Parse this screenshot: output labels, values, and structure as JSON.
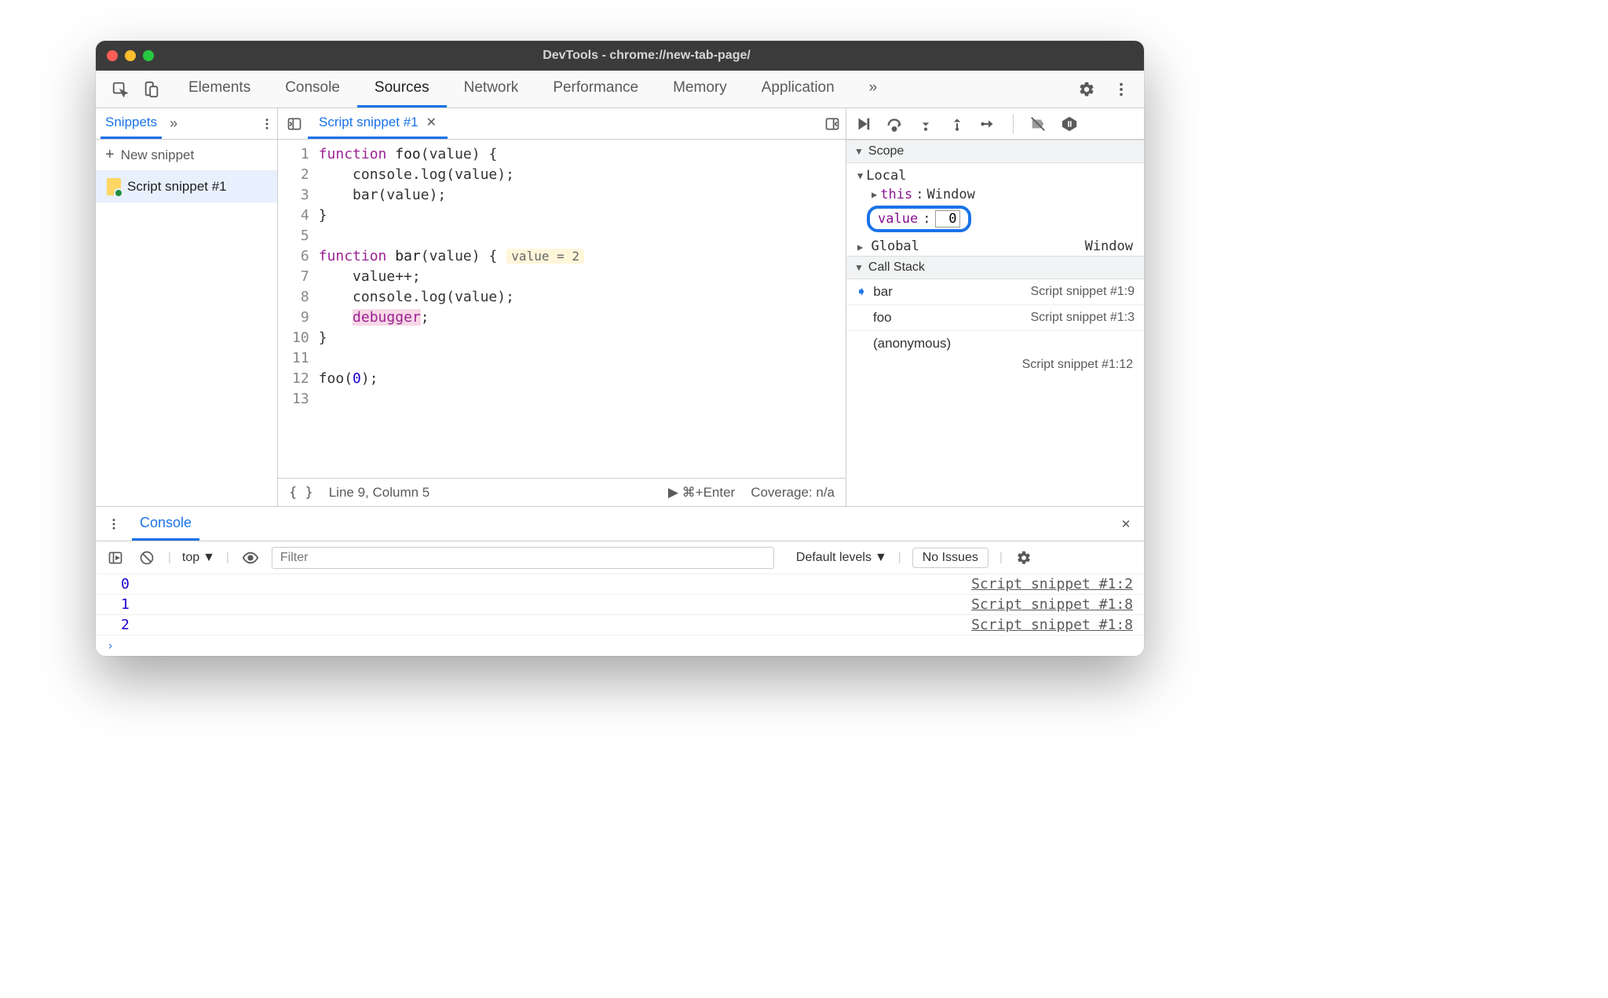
{
  "window": {
    "title": "DevTools - chrome://new-tab-page/"
  },
  "main_tabs": [
    "Elements",
    "Console",
    "Sources",
    "Network",
    "Performance",
    "Memory",
    "Application"
  ],
  "main_tab_active": "Sources",
  "sidebar": {
    "nav_label": "Snippets",
    "new_snippet": "New snippet",
    "items": [
      "Script snippet #1"
    ]
  },
  "editor": {
    "open_file": "Script snippet #1",
    "lines": [
      "function foo(value) {",
      "    console.log(value);",
      "    bar(value);",
      "}",
      "",
      "function bar(value) {",
      "    value++;",
      "    console.log(value);",
      "    debugger;",
      "}",
      "",
      "foo(0);",
      ""
    ],
    "inline_hint": "value = 2",
    "exec_line": 9,
    "status": {
      "cursor": "Line 9, Column 5",
      "run_hint": "⌘+Enter",
      "coverage": "Coverage: n/a"
    }
  },
  "debugger": {
    "scope_label": "Scope",
    "local_label": "Local",
    "local": {
      "this_key": "this",
      "this_val": "Window",
      "value_key": "value",
      "value_val": "0"
    },
    "global_key": "Global",
    "global_val": "Window",
    "call_stack_label": "Call Stack",
    "stack": [
      {
        "fn": "bar",
        "loc": "Script snippet #1:9",
        "active": true
      },
      {
        "fn": "foo",
        "loc": "Script snippet #1:3",
        "active": false
      }
    ],
    "anonymous": "(anonymous)",
    "anonymous_loc": "Script snippet #1:12"
  },
  "drawer": {
    "tab": "Console",
    "context": "top",
    "filter_placeholder": "Filter",
    "levels": "Default levels",
    "issues": "No Issues",
    "logs": [
      {
        "v": "0",
        "loc": "Script snippet #1:2"
      },
      {
        "v": "1",
        "loc": "Script snippet #1:8"
      },
      {
        "v": "2",
        "loc": "Script snippet #1:8"
      }
    ]
  }
}
